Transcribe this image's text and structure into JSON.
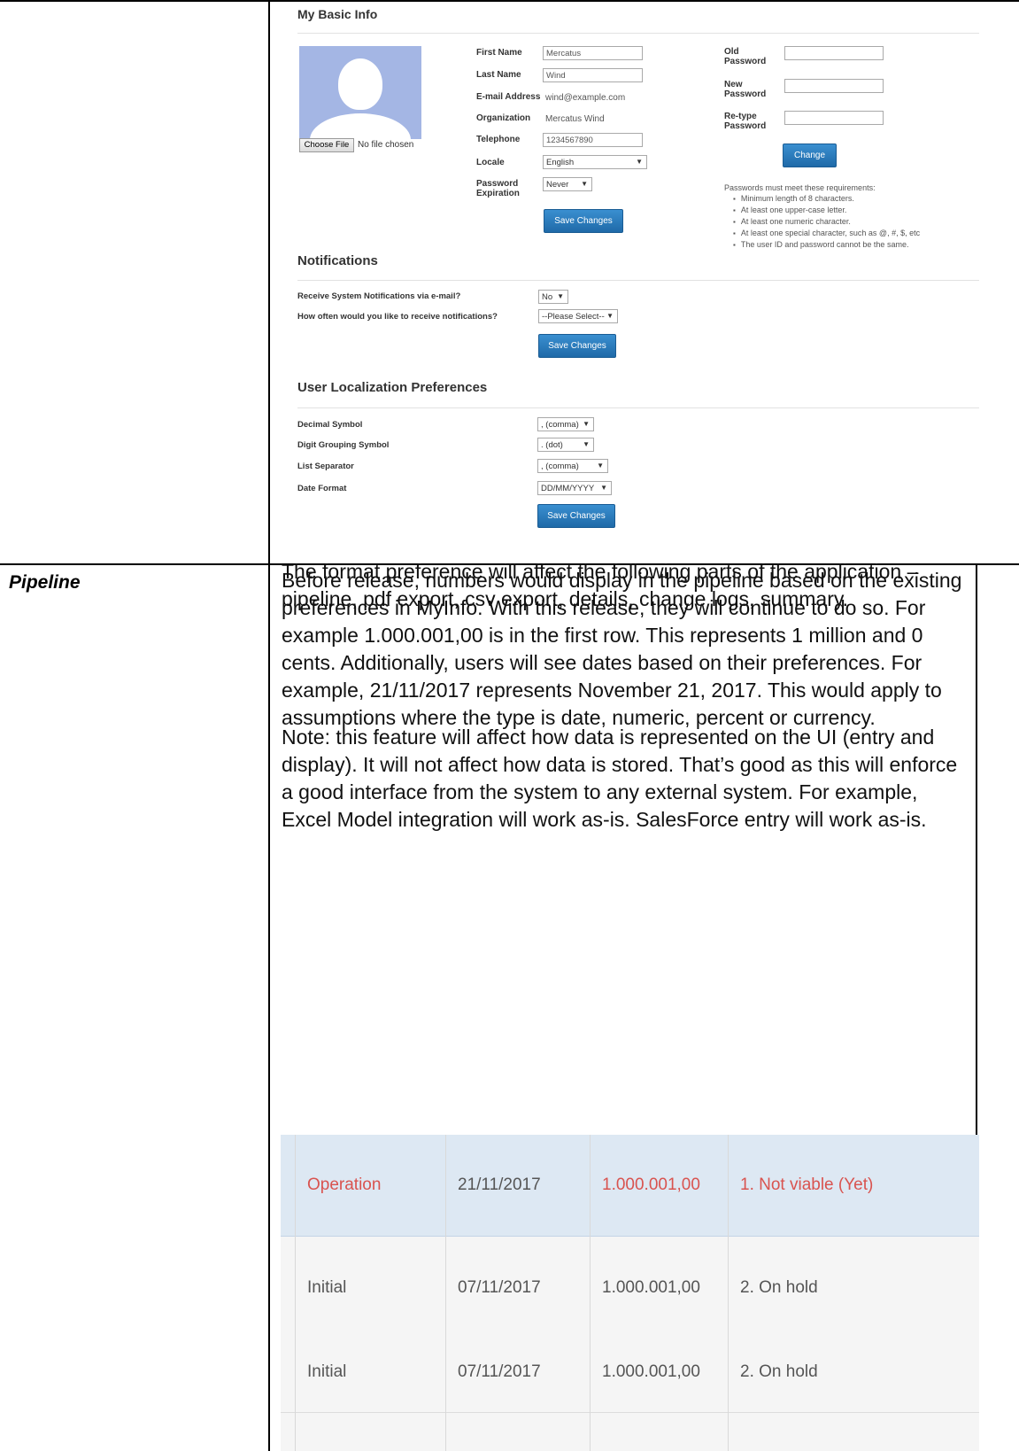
{
  "basic_info": {
    "title": "My Basic Info",
    "choose_file": "Choose File",
    "no_file": "No file chosen",
    "fields": [
      {
        "label": "First Name",
        "value": "Mercatus"
      },
      {
        "label": "Last Name",
        "value": "Wind"
      },
      {
        "label": "E-mail Address",
        "value": "wind@example.com"
      },
      {
        "label": "Organization",
        "value": "Mercatus Wind"
      },
      {
        "label": "Telephone",
        "value": "1234567890"
      },
      {
        "label": "Locale",
        "value": "English"
      },
      {
        "label_line1": "Password",
        "label_line2": "Expiration",
        "value": "Never"
      }
    ],
    "password": {
      "old_l1": "Old",
      "old_l2": "Password",
      "new_l1": "New",
      "new_l2": "Password",
      "retype_l1": "Re-type",
      "retype_l2": "Password",
      "change_button": "Change",
      "requirements_title": "Passwords must meet these requirements:",
      "requirements": [
        "Minimum length of 8 characters.",
        "At least one upper-case letter.",
        "At least one numeric character.",
        "At least one special character, such as @, #, $, etc",
        "The user ID and password cannot be the same."
      ]
    },
    "save_button": "Save Changes"
  },
  "notifications": {
    "title": "Notifications",
    "q1": "Receive System Notifications via e-mail?",
    "q1_value": "No",
    "q2": "How often would you like to receive notifications?",
    "q2_value": "--Please Select--",
    "save_button": "Save Changes"
  },
  "localization": {
    "title": "User Localization Preferences",
    "rows": [
      {
        "label": "Decimal Symbol",
        "value": ", (comma)"
      },
      {
        "label": "Digit Grouping Symbol",
        "value": ". (dot)"
      },
      {
        "label": "List Separator",
        "value": ", (comma)"
      },
      {
        "label": "Date Format",
        "value": "DD/MM/YYYY"
      }
    ],
    "save_button": "Save Changes"
  },
  "doc": {
    "para1": "The format preference will affect the following parts of the application – pipeline, pdf export, csv export, details, change logs, summary.",
    "para2": "Note: this feature will affect how data is represented on the UI (entry and display).  It will not affect how data is stored.  That’s good as this will enforce a good interface from the system to any external system.  For example, Excel Model integration will work as-is.  SalesForce entry will work as-is.",
    "pipeline_label": "Pipeline",
    "para3": "Before release, numbers would display in the pipeline based on the existing preferences in MyInfo.  With this release, they will continue to do so.  For example 1.000.001,00 is in the first row.  This represents 1 million and 0 cents.  Additionally, users will see dates based on their preferences.  For example, 21/11/2017 represents November 21, 2017.  This would apply to assumptions where the type is date, numeric, percent or currency."
  },
  "pipeline_rows": [
    [
      "Operation",
      "21/11/2017",
      "1.000.001,00",
      "1. Not viable (Yet)"
    ],
    [
      "Initial",
      "07/11/2017",
      "1.000.001,00",
      "2. On hold"
    ],
    [
      "Initial",
      "07/11/2017",
      "1.000.001,00",
      "2. On hold"
    ]
  ],
  "colors": {
    "highlight_row": "#dde8f3",
    "red_text": "#d9534f",
    "button": "#2a78bd"
  }
}
